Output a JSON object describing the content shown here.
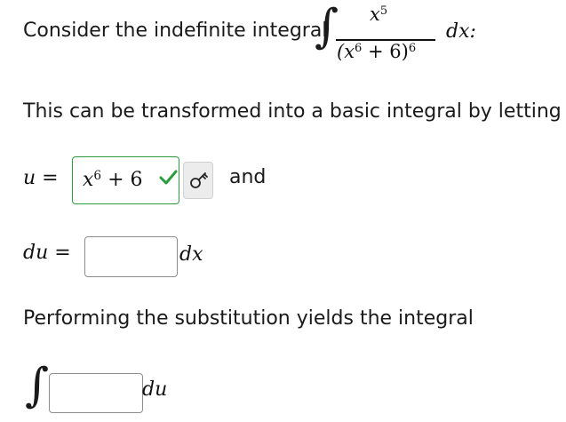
{
  "question": {
    "prefix": "Consider the indefinite integral",
    "integral_symbol": "∫",
    "numerator_base": "x",
    "numerator_exp": "5",
    "denominator_open": "(x",
    "denominator_inner_exp": "6",
    "denominator_rest": " + 6)",
    "denominator_exp": "6",
    "differential": "dx:"
  },
  "transform_text": "This can be transformed into a basic integral by letting",
  "u_row": {
    "label": "u =",
    "value_base": "x",
    "value_exp": "6",
    "value_rest": " + 6",
    "status": "correct",
    "check_color": "#2e9b3e",
    "key_icon": "key-icon",
    "and_text": "and"
  },
  "du_row": {
    "label": "du =",
    "input_value": "",
    "differential": "dx"
  },
  "perform_text": "Performing the substitution yields the integral",
  "final": {
    "integral_symbol": "∫",
    "input_value": "",
    "differential": "du"
  }
}
